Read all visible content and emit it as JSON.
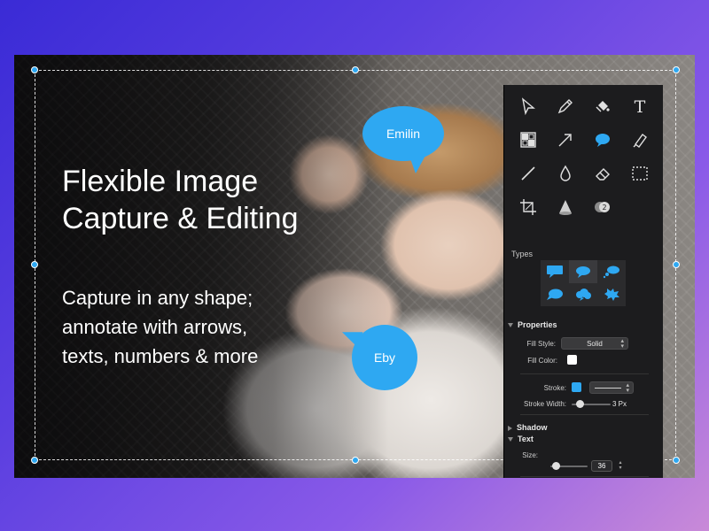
{
  "headline": "Flexible Image\nCapture & Editing",
  "subline": "Capture in any shape;\nannotate with arrows,\ntexts, numbers & more",
  "bubbles": {
    "emilin": "Emilin",
    "eby": "Eby"
  },
  "colors": {
    "accent": "#2ea8f2",
    "panel_bg": "#1c1c1e"
  },
  "tools": [
    {
      "name": "pointer-icon"
    },
    {
      "name": "pencil-icon"
    },
    {
      "name": "fill-bucket-icon"
    },
    {
      "name": "text-icon",
      "glyph": "T"
    },
    {
      "name": "pixelate-icon"
    },
    {
      "name": "arrow-icon"
    },
    {
      "name": "speech-bubble-icon"
    },
    {
      "name": "highlighter-icon"
    },
    {
      "name": "line-icon"
    },
    {
      "name": "blur-drop-icon"
    },
    {
      "name": "eraser-icon"
    },
    {
      "name": "selection-icon"
    },
    {
      "name": "crop-icon"
    },
    {
      "name": "spotlight-icon"
    },
    {
      "name": "counter-icon",
      "glyph": "2"
    }
  ],
  "types": {
    "label": "Types",
    "items": [
      "rect-bubble",
      "oval-bubble",
      "thought-bubble",
      "round-bubble",
      "cloud-bubble",
      "shout-bubble"
    ],
    "selected_index": 1
  },
  "properties": {
    "title": "Properties",
    "fill_style_label": "Fill Style:",
    "fill_style_value": "Solid",
    "fill_color_label": "Fill Color:",
    "fill_color": "#ffffff",
    "stroke_label": "Stroke:",
    "stroke_color": "#2ea8f2",
    "stroke_width_label": "Stroke Width:",
    "stroke_width_value": "3 Px",
    "stroke_width_fraction": 0.2
  },
  "shadow": {
    "title": "Shadow"
  },
  "text": {
    "title": "Text",
    "size_label": "Size:",
    "size_value": "36",
    "size_fraction": 0.15
  }
}
